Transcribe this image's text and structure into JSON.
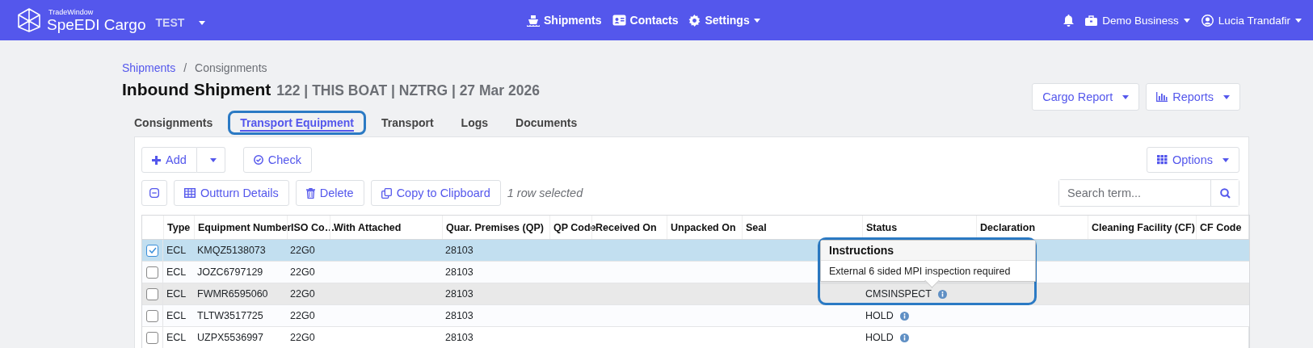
{
  "navbar": {
    "brand_small": "TradeWindow",
    "brand": "SpeEDI Cargo",
    "environment": "TEST",
    "menu": [
      {
        "label": "Shipments",
        "kind": "ship",
        "dropdown": false
      },
      {
        "label": "Contacts",
        "kind": "contacts",
        "dropdown": false
      },
      {
        "label": "Settings",
        "kind": "gear",
        "dropdown": true
      }
    ],
    "business": "Demo Business",
    "user": "Lucia Trandafir"
  },
  "breadcrumb_separator": "/",
  "breadcrumbs": [
    {
      "label": "Shipments",
      "link": true
    },
    {
      "label": "Consignments",
      "link": false
    }
  ],
  "title": "Inbound Shipment",
  "subtitle": "122 | THIS BOAT | NZTRG | 27 Mar 2026",
  "header_buttons": [
    {
      "label": "Cargo Report",
      "kind": "plain"
    },
    {
      "label": "Reports",
      "kind": "chart"
    }
  ],
  "tabs": [
    {
      "label": "Consignments",
      "selected": false,
      "highlighted": false
    },
    {
      "label": "Transport Equipment",
      "selected": true,
      "highlighted": true
    },
    {
      "label": "Transport",
      "selected": false,
      "highlighted": false
    },
    {
      "label": "Logs",
      "selected": false,
      "highlighted": false
    },
    {
      "label": "Documents",
      "selected": false,
      "highlighted": false
    }
  ],
  "toolbar": {
    "add": "Add",
    "check": "Check",
    "options": "Options",
    "outturn": "Outturn Details",
    "delete": "Delete",
    "copy": "Copy to Clipboard",
    "selection_info": "1 row selected",
    "search": {
      "placeholder": "Search term..."
    }
  },
  "table": {
    "columns": [
      "Type",
      "Equipment Number",
      "ISO Co…",
      "With Attached",
      "Quar. Premises (QP)",
      "QP Code",
      "Received On",
      "Unpacked On",
      "Seal",
      "Status",
      "Declaration",
      "Cleaning Facility (CF)",
      "CF Code"
    ],
    "rows": [
      {
        "selected": true,
        "hovered": false,
        "type": "ECL",
        "equipment": "KMQZ5138073",
        "iso": "22G0",
        "qp": "28103",
        "status": ""
      },
      {
        "selected": false,
        "hovered": false,
        "type": "ECL",
        "equipment": "JOZC6797129",
        "iso": "22G0",
        "qp": "28103",
        "status": ""
      },
      {
        "selected": false,
        "hovered": true,
        "type": "ECL",
        "equipment": "FWMR6595060",
        "iso": "22G0",
        "qp": "28103",
        "status": "CMSINSPECT"
      },
      {
        "selected": false,
        "hovered": false,
        "type": "ECL",
        "equipment": "TLTW3517725",
        "iso": "22G0",
        "qp": "28103",
        "status": "HOLD"
      },
      {
        "selected": false,
        "hovered": false,
        "type": "ECL",
        "equipment": "UZPX5536997",
        "iso": "22G0",
        "qp": "28103",
        "status": "HOLD"
      }
    ]
  },
  "popover": {
    "title": "Instructions",
    "text": "External 6 sided MPI inspection required",
    "highlighted": true
  }
}
